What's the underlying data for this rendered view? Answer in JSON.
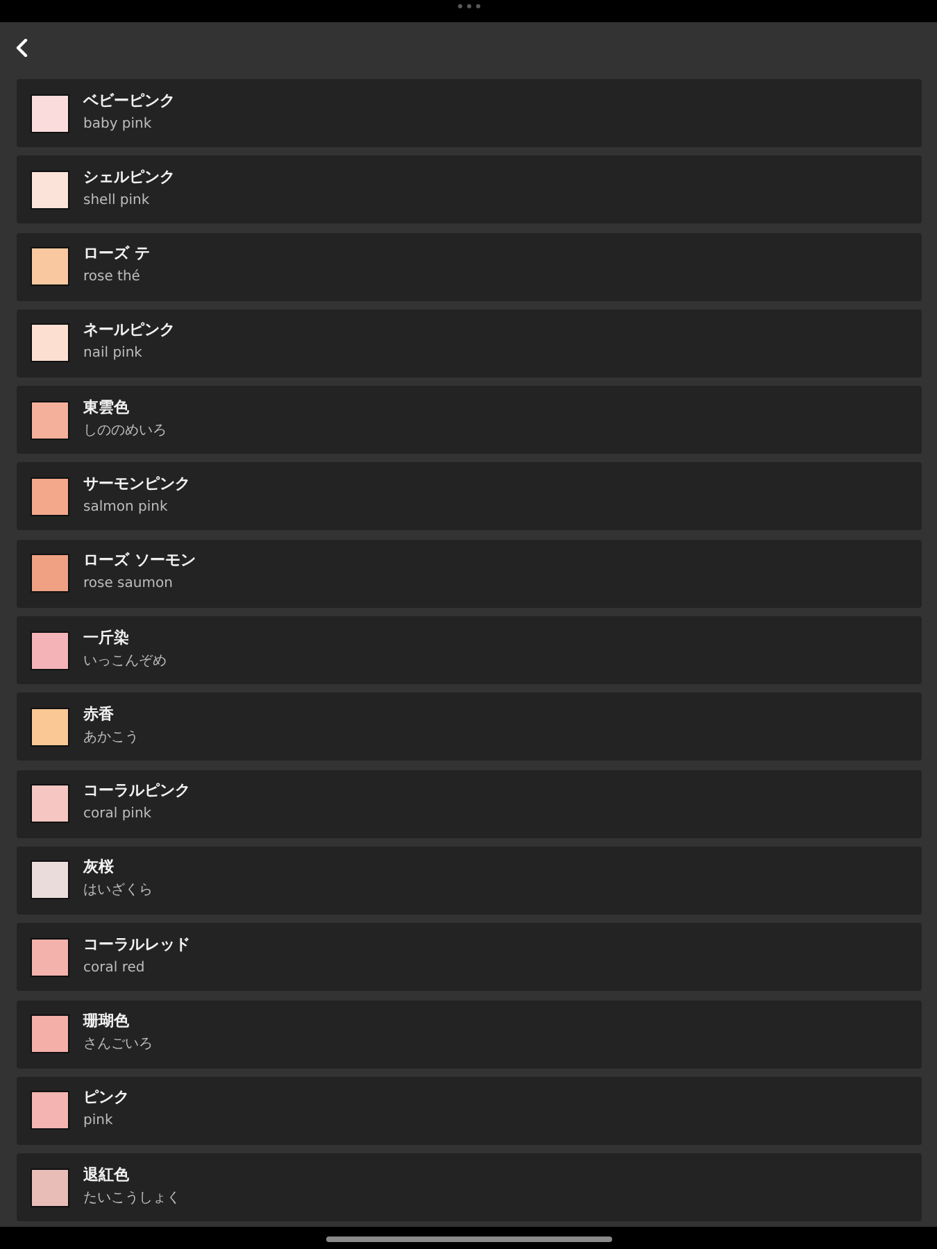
{
  "colors": [
    {
      "name": "ベビーピンク",
      "reading": "baby pink",
      "color": "#fbdcdc"
    },
    {
      "name": "シェルピンク",
      "reading": "shell pink",
      "color": "#fce3d9"
    },
    {
      "name": "ローズ テ",
      "reading": "rose thé",
      "color": "#f9c8a0"
    },
    {
      "name": "ネールピンク",
      "reading": "nail pink",
      "color": "#fcdfd1"
    },
    {
      "name": "東雲色",
      "reading": "しののめいろ",
      "color": "#f4b09a"
    },
    {
      "name": "サーモンピンク",
      "reading": "salmon pink",
      "color": "#f3a78b"
    },
    {
      "name": "ローズ ソーモン",
      "reading": "rose saumon",
      "color": "#f0a184"
    },
    {
      "name": "一斤染",
      "reading": "いっこんぞめ",
      "color": "#f4b3b6"
    },
    {
      "name": "赤香",
      "reading": "あかこう",
      "color": "#f9c895"
    },
    {
      "name": "コーラルピンク",
      "reading": "coral pink",
      "color": "#f6c7c2"
    },
    {
      "name": "灰桜",
      "reading": "はいざくら",
      "color": "#ebdcdc"
    },
    {
      "name": "コーラルレッド",
      "reading": "coral red",
      "color": "#f3b2ab"
    },
    {
      "name": "珊瑚色",
      "reading": "さんごいろ",
      "color": "#f4afa8"
    },
    {
      "name": "ピンク",
      "reading": "pink",
      "color": "#f4b4b1"
    },
    {
      "name": "退紅色",
      "reading": "たいこうしょく",
      "color": "#e8bdb8"
    }
  ]
}
